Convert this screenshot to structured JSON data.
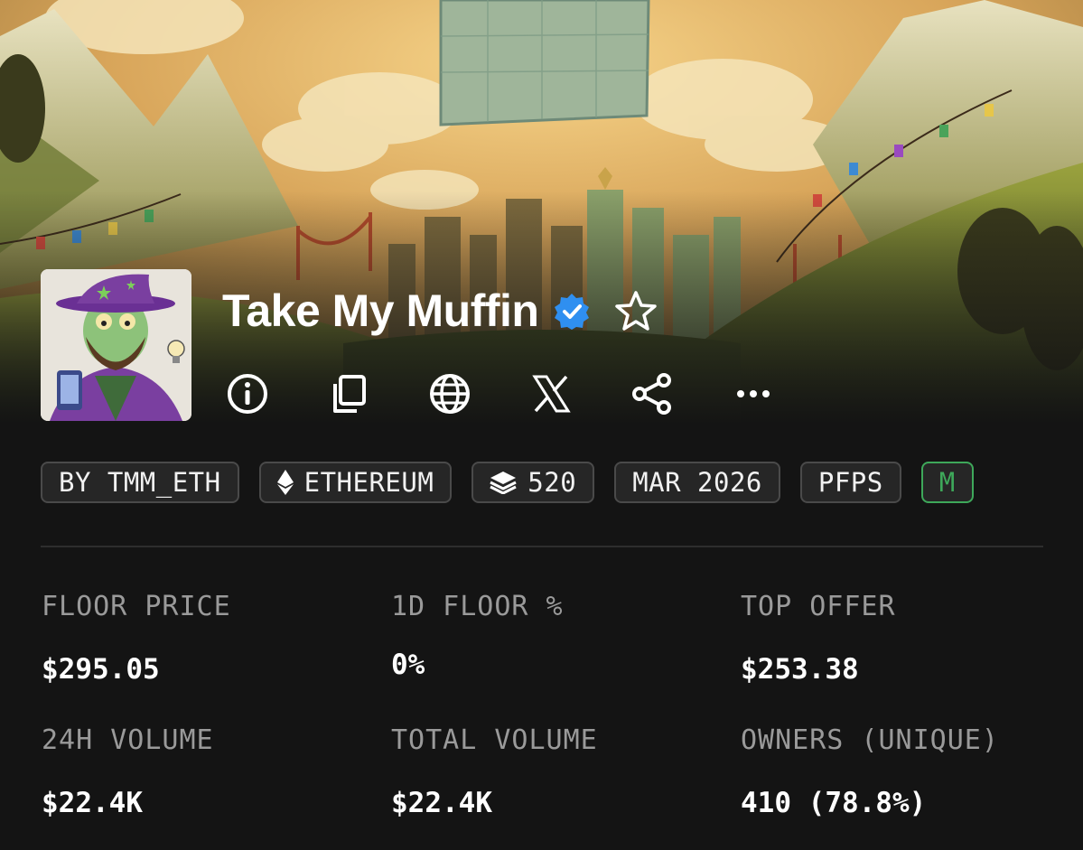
{
  "collection": {
    "name": "Take My Muffin",
    "verified": true,
    "favorite_icon": "star-outline-icon",
    "verified_icon": "verified-badge-icon"
  },
  "actions": [
    {
      "name": "info-icon"
    },
    {
      "name": "copy-icon"
    },
    {
      "name": "globe-icon"
    },
    {
      "name": "x-logo-icon"
    },
    {
      "name": "share-icon"
    },
    {
      "name": "more-icon"
    }
  ],
  "chips": {
    "creator": "BY TMM_ETH",
    "chain": "ETHEREUM",
    "items": "520",
    "date": "MAR 2026",
    "category": "PFPS",
    "extra": "M"
  },
  "stats": {
    "floor_price": {
      "label": "FLOOR PRICE",
      "value": "$295.05"
    },
    "floor_change": {
      "label": "1D FLOOR %",
      "value": "0%"
    },
    "top_offer": {
      "label": "TOP OFFER",
      "value": "$253.38"
    },
    "volume_24h": {
      "label": "24H VOLUME",
      "value": "$22.4K"
    },
    "total_volume": {
      "label": "TOTAL VOLUME",
      "value": "$22.4K"
    },
    "owners": {
      "label": "OWNERS (UNIQUE)",
      "value": "410 (78.8%)"
    }
  },
  "colors": {
    "background": "#141414",
    "verified_blue": "#2f8ff0",
    "accent_green": "#3ea85a",
    "chip_border": "#4a4a4a",
    "label_gray": "#9a9a9a"
  }
}
